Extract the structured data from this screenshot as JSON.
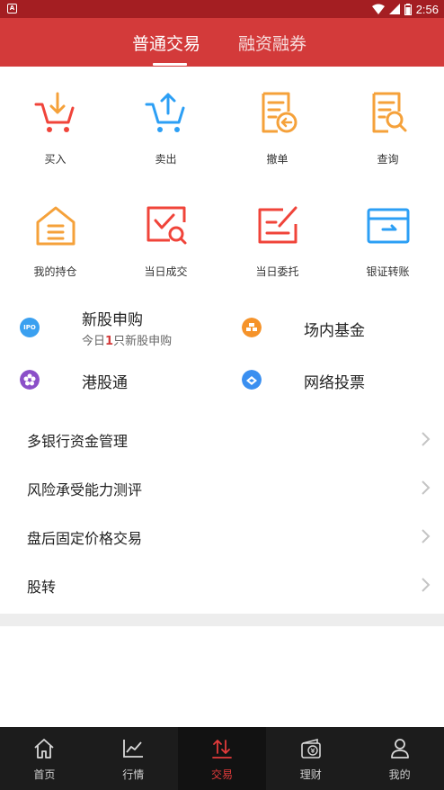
{
  "status_bar": {
    "time": "2:56",
    "notification_icon": "A"
  },
  "header": {
    "tabs": [
      {
        "label": "普通交易",
        "active": true
      },
      {
        "label": "融资融券",
        "active": false
      }
    ]
  },
  "grid": [
    {
      "label": "买入",
      "icon": "cart-in-icon"
    },
    {
      "label": "卖出",
      "icon": "cart-out-icon"
    },
    {
      "label": "撤单",
      "icon": "cancel-order-icon"
    },
    {
      "label": "查询",
      "icon": "query-doc-icon"
    },
    {
      "label": "我的持仓",
      "icon": "house-icon"
    },
    {
      "label": "当日成交",
      "icon": "deal-check-icon"
    },
    {
      "label": "当日委托",
      "icon": "entrust-edit-icon"
    },
    {
      "label": "银证转账",
      "icon": "transfer-card-icon"
    }
  ],
  "services": {
    "ipo": {
      "title": "新股申购",
      "sub_prefix": "今日",
      "sub_count": "1",
      "sub_suffix": "只新股申购",
      "badge": "IPO"
    },
    "fund": {
      "title": "场内基金"
    },
    "hk": {
      "title": "港股通"
    },
    "vote": {
      "title": "网络投票"
    }
  },
  "list": [
    {
      "label": "多银行资金管理"
    },
    {
      "label": "风险承受能力测评"
    },
    {
      "label": "盘后固定价格交易"
    },
    {
      "label": "股转"
    }
  ],
  "tabbar": [
    {
      "label": "首页",
      "icon": "home-icon",
      "active": false
    },
    {
      "label": "行情",
      "icon": "chart-icon",
      "active": false
    },
    {
      "label": "交易",
      "icon": "trade-arrows-icon",
      "active": true
    },
    {
      "label": "理财",
      "icon": "wallet-icon",
      "active": false
    },
    {
      "label": "我的",
      "icon": "person-icon",
      "active": false
    }
  ],
  "colors": {
    "brand_red": "#d33a3a",
    "icon_red": "#f0443a",
    "icon_orange": "#f5a13a",
    "icon_blue": "#2c9ff5",
    "tabbar_bg": "#1c1c1c"
  }
}
